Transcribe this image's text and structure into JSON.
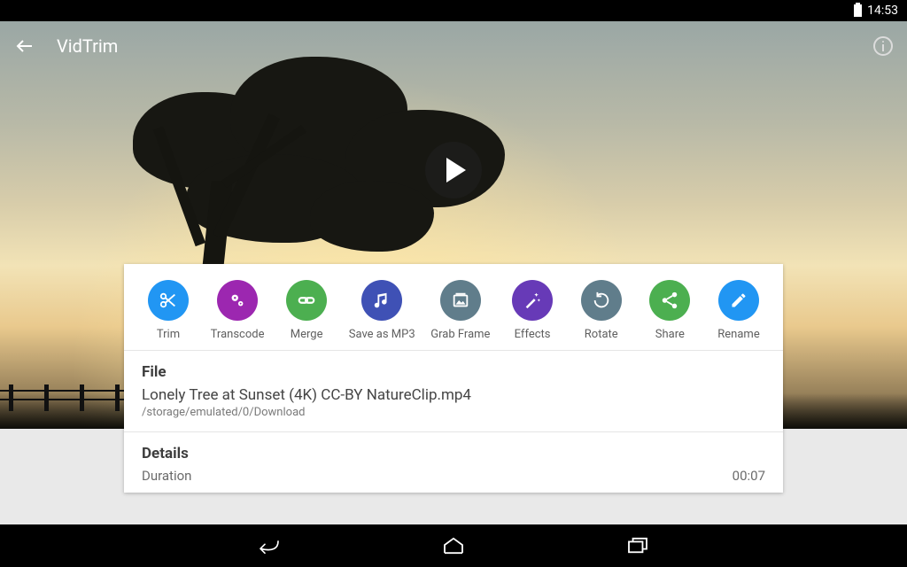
{
  "statusbar": {
    "time": "14:53"
  },
  "appbar": {
    "title": "VidTrim"
  },
  "actions": {
    "trim": "Trim",
    "transcode": "Transcode",
    "merge": "Merge",
    "save_mp3": "Save as MP3",
    "grab_frame": "Grab Frame",
    "effects": "Effects",
    "rotate": "Rotate",
    "share": "Share",
    "rename": "Rename"
  },
  "file": {
    "heading": "File",
    "name": "Lonely Tree at Sunset (4K) CC-BY NatureClip.mp4",
    "path": "/storage/emulated/0/Download"
  },
  "details": {
    "heading": "Details",
    "duration_label": "Duration",
    "duration_value": "00:07"
  }
}
